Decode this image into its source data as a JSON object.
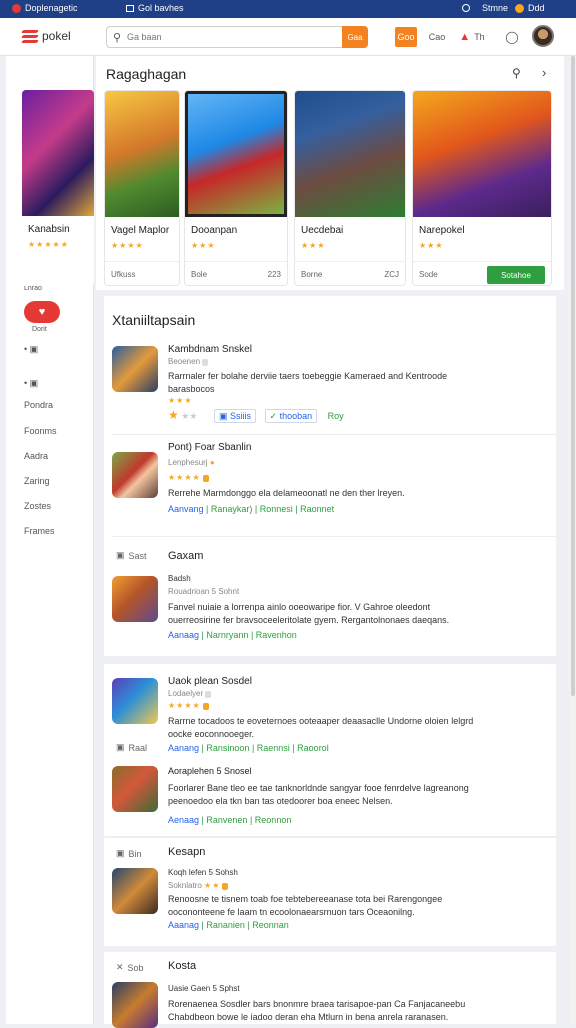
{
  "osbar": {
    "left_title": "Doplenagetic",
    "tab_label": "Gol bavhes",
    "right_label": "Stmne",
    "right_label2": "Ddd"
  },
  "header": {
    "logo_text": "pokel",
    "search_placeholder": "Ga baan",
    "search_button": "Gaa",
    "btn_orange": "Goo",
    "btn_text": "Cao",
    "btn_alert": "Th"
  },
  "sidebar": {
    "items": [
      "Lnrao",
      "Dorit",
      "Pondra",
      "Foonms",
      "Aadra",
      "Zaring",
      "Zostes",
      "Frames"
    ]
  },
  "featured": {
    "title": "Ragaghagan",
    "cards": [
      {
        "title": "Kanabsin",
        "footer_left": "",
        "footer_right": ""
      },
      {
        "title": "Vagel Maplor",
        "footer_left": "Ufkuss",
        "footer_right": ""
      },
      {
        "title": "Dooanpan",
        "footer_left": "Bole",
        "footer_right": "223"
      },
      {
        "title": "Uecdebai",
        "footer_left": "Borne",
        "footer_right": "ZCJ"
      },
      {
        "title": "Narepokel",
        "footer_left": "Sode",
        "footer_right": "",
        "button": "Sotahoe"
      }
    ]
  },
  "list": {
    "title": "Xtaniiltapsain",
    "entries": [
      {
        "name": "Kambdnam Snskel",
        "meta": "Beoenen",
        "desc1": "Rarrnaler fer bolahe derviie taers toebeggie Kameraed and Kentroode",
        "desc2": "barasbocos",
        "links": [
          "Ssiiis",
          "thooban",
          "Roy"
        ]
      },
      {
        "name": "Pont) Foar Sbanlin",
        "meta": "Lenphesurj",
        "desc1": "Rerrehe Marmdonggo ela delameoonatl ne den ther lreyen.",
        "desc2": "",
        "links": [
          "Aanvang",
          "Ranaykar)",
          "Ronnesi",
          "Raonnet"
        ]
      },
      {
        "label": "Sast",
        "name": "Gaxam",
        "sub": "Badsh",
        "meta": "Rouadrioan 5 Sohnt",
        "desc1": "Fanvel nuiaie a lorrenpa ainlo ooeowaripe fior. V Gahroe oleedont",
        "desc2": "ouerreosirine fer bravsoceeleritolate gyem. Rergantolnonaes daeqans.",
        "links": [
          "Aanaag",
          "Narnryann",
          "Ravenhon"
        ]
      },
      {
        "name": "Uaok plean Sosdel",
        "meta": "Lodaelyer",
        "desc1": "Rarrne tocadoos te eoveternoes ooteaaper deaasaclle Undorne oloien lelgrd",
        "desc2": "oocke eoconnooeger.",
        "links": [
          "Aanang",
          "Ransinoon",
          "Raennsi",
          "Raoorol"
        ]
      },
      {
        "label": "Raal",
        "name": "Aoraplehen 5 Snosel",
        "meta": "",
        "desc1": "Foorlarer Bane tleo ee tae tanknorldnde sangyar fooe fenrdelve lagreanong",
        "desc2": "peenoedoo ela tkn ban tas otedoorer boa eneec Nelsen.",
        "links": [
          "Aenaag",
          "Ranvenen",
          "Reonnon"
        ]
      },
      {
        "label": "Bin",
        "name": "Kesapn",
        "sub": "Koqh lefen 5 Sohsh",
        "meta": "Soknlatro",
        "desc1": "Renoosne te tisnem toab foe tebtebereeanase tota bei Rarengongee",
        "desc2": "oocononteene fe laam tn ecoolonaearsrnuon tars Oceaonilng.",
        "links": [
          "Aaanag",
          "Rananien",
          "Reonnan"
        ]
      },
      {
        "label": "Sob",
        "name": "Kosta",
        "sub": "Uasie Gaen 5 Sphst",
        "meta": "",
        "desc1": "Rorenaenea Sosdler bars bnonmre braea tarisapoe-pan Ca Fanjacaneebu",
        "desc2": "Chabdbeon bowe le iadoo deran eha Mtlurn in bena anrela raranasen.",
        "links": []
      }
    ]
  },
  "colors": {
    "accent_red": "#e53935",
    "accent_orange": "#f58220",
    "link_blue": "#2563eb",
    "link_green": "#2e9e3e",
    "os_bar": "#1f3f86"
  }
}
